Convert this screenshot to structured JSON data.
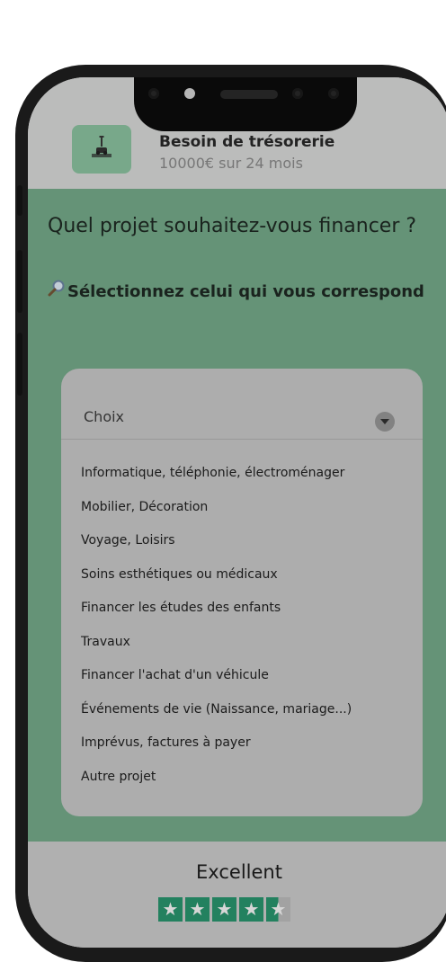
{
  "header": {
    "title": "Besoin de trésorerie",
    "subtitle": "10000€ sur 24 mois",
    "logo_icon": "vehicle-lift-icon"
  },
  "main": {
    "question": "Quel projet souhaitez-vous financer ?",
    "select_hint": "Sélectionnez celui qui vous correspond",
    "hint_icon": "magnifier-icon"
  },
  "dropdown": {
    "selected": "Choix",
    "options": [
      "Informatique, téléphonie, électroménager",
      "Mobilier, Décoration",
      "Voyage, Loisirs",
      "Soins esthétiques ou médicaux",
      "Financer les études des enfants",
      "Travaux",
      "Financer l'achat d'un véhicule",
      " Événements de vie (Naissance, mariage...)",
      "Imprévus, factures à payer",
      "Autre projet"
    ]
  },
  "rating": {
    "label": "Excellent",
    "stars": 4.5,
    "star_color": "#2a9a72"
  },
  "colors": {
    "accent_green": "#79b08e"
  }
}
